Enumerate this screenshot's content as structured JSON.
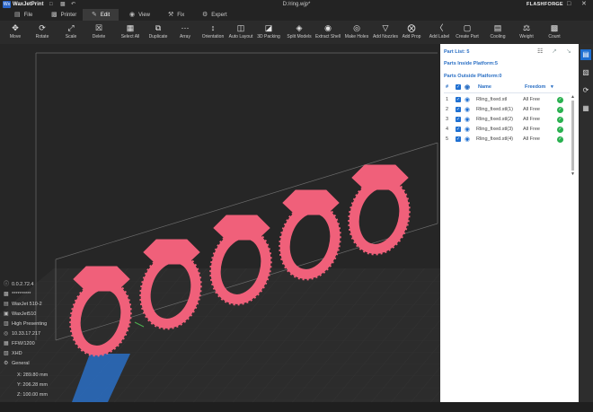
{
  "app": {
    "name": "WaxJetPrint",
    "logo_text": "Wx",
    "document_title": "D:/ring.wjp*",
    "brand": "FLASHFORGE",
    "quick_icons": [
      "file-icon",
      "save-icon",
      "undo-icon"
    ],
    "window_controls": [
      "minimize-icon",
      "maximize-icon",
      "close-icon"
    ]
  },
  "menu": [
    {
      "label": "File",
      "icon": "folder-icon"
    },
    {
      "label": "Printer",
      "icon": "printer-icon"
    },
    {
      "label": "Edit",
      "icon": "edit-icon",
      "active": true
    },
    {
      "label": "View",
      "icon": "eye-icon"
    },
    {
      "label": "Fix",
      "icon": "wrench-icon"
    },
    {
      "label": "Expert",
      "icon": "expert-icon"
    }
  ],
  "toolbar": [
    {
      "label": "Move",
      "icon": "move-icon"
    },
    {
      "label": "Rotate",
      "icon": "rotate-icon"
    },
    {
      "label": "Scale",
      "icon": "scale-icon"
    },
    {
      "label": "Delete",
      "icon": "delete-icon"
    },
    {
      "label": "Select All",
      "icon": "select-all-icon"
    },
    {
      "label": "Duplicate",
      "icon": "duplicate-icon"
    },
    {
      "label": "Array",
      "icon": "array-icon"
    },
    {
      "label": "Orientation",
      "icon": "orientation-icon"
    },
    {
      "label": "Auto Layout",
      "icon": "auto-layout-icon"
    },
    {
      "label": "3D Packing",
      "icon": "packing-icon"
    },
    {
      "label": "Split Models",
      "icon": "split-icon"
    },
    {
      "label": "Extract Shell",
      "icon": "shell-icon"
    },
    {
      "label": "Make Holes",
      "icon": "holes-icon"
    },
    {
      "label": "Add Nozzles",
      "icon": "nozzle-icon"
    },
    {
      "label": "Add Prop",
      "icon": "prop-icon"
    },
    {
      "label": "Add Label",
      "icon": "label-icon"
    },
    {
      "label": "Create Part",
      "icon": "create-part-icon"
    },
    {
      "label": "Cooling",
      "icon": "cooling-icon"
    },
    {
      "label": "Weight",
      "icon": "weight-icon"
    },
    {
      "label": "Count",
      "icon": "count-icon"
    }
  ],
  "printer_info": [
    {
      "icon": "version-icon",
      "text": "0.0.2.72.4"
    },
    {
      "icon": "serial-icon",
      "text": "**********"
    },
    {
      "icon": "printer-icon",
      "text": "WaxJet 510-2"
    },
    {
      "icon": "material-icon",
      "text": "WaxJet510"
    },
    {
      "icon": "quality-icon",
      "text": "High Presenting"
    },
    {
      "icon": "network-icon",
      "text": "10.33.17.217"
    },
    {
      "icon": "firmware-icon",
      "text": "FFW/1200"
    },
    {
      "icon": "resolution-icon",
      "text": "XHD"
    },
    {
      "icon": "settings-icon",
      "text": "General"
    }
  ],
  "coords": {
    "x": "X: 289.80 mm",
    "y": "Y: 206.28 mm",
    "z": "Z: 100.00 mm"
  },
  "panel": {
    "part_list": "Part List: 5",
    "inside": "Parts Inside Platform:5",
    "outside": "Parts Outside Platform:0",
    "header_icons": [
      "list-view-icon",
      "expand-icon",
      "collapse-icon"
    ],
    "columns": {
      "num": "#",
      "name": "Name",
      "freedom": "Freedom"
    },
    "parts": [
      {
        "num": "1",
        "name": "Rling_fixed.stl",
        "freedom": "All Free"
      },
      {
        "num": "2",
        "name": "Rling_fixed.stl(1)",
        "freedom": "All Free"
      },
      {
        "num": "3",
        "name": "Rling_fixed.stl(2)",
        "freedom": "All Free"
      },
      {
        "num": "4",
        "name": "Rling_fixed.stl(3)",
        "freedom": "All Free"
      },
      {
        "num": "5",
        "name": "Rling_fixed.stl(4)",
        "freedom": "All Free"
      }
    ]
  },
  "sidebar": [
    {
      "icon": "parts-list-icon",
      "active": true
    },
    {
      "icon": "clipboard-icon"
    },
    {
      "icon": "history-icon"
    },
    {
      "icon": "report-icon"
    }
  ],
  "colors": {
    "ring": "#f0607a",
    "accent": "#1e6fd1",
    "ok": "#29b04f"
  }
}
